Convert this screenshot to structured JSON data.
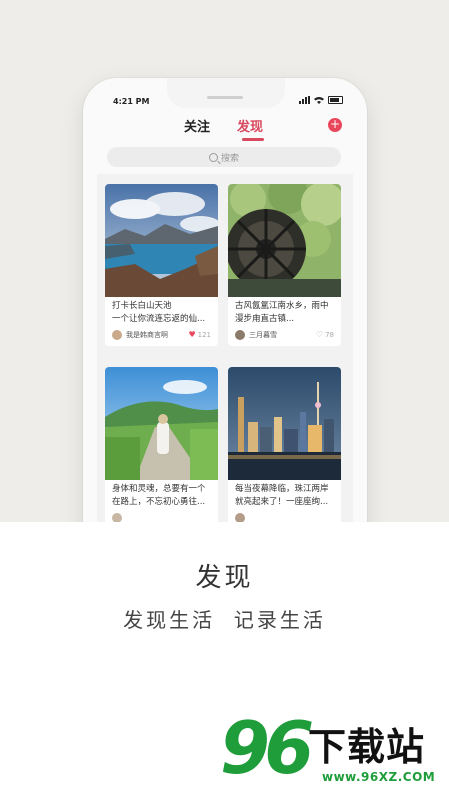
{
  "status": {
    "time": "4:21 PM"
  },
  "tabs": [
    {
      "label": "关注"
    },
    {
      "label": "发现"
    }
  ],
  "add_button": "+",
  "search": {
    "placeholder": "搜索"
  },
  "feed": {
    "cards": [
      {
        "text": "打卡长白山天池\n一个让你流连忘返的仙...",
        "author": "我是韩商言啊",
        "likes": "121",
        "liked": true
      },
      {
        "text": "古风氤氲江南水乡，雨中漫步甪直古镇...",
        "author": "三月暮雪",
        "likes": "78",
        "liked": false
      },
      {
        "text": "身体和灵魂，总要有一个在路上，不忘初心勇往...",
        "author": "",
        "likes": "",
        "liked": false
      },
      {
        "text": "每当夜幕降临，珠江两岸就亮起来了！一座座绚...",
        "author": "",
        "likes": "",
        "liked": false
      }
    ]
  },
  "promo": {
    "title": "发现",
    "subtitle": "发现生活  记录生活"
  },
  "logo": {
    "number": "96",
    "name": "下载站",
    "url": "www.96XZ.COM"
  },
  "colors": {
    "accent": "#d8485e",
    "logo_green": "#1e9d3a"
  }
}
